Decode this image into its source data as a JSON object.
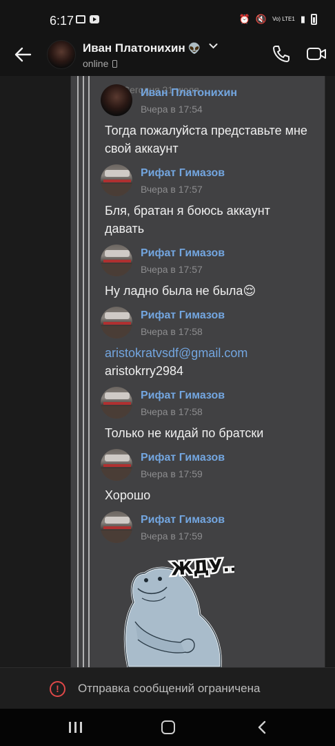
{
  "status_bar": {
    "time": "6:17",
    "signal": "Vo) LTE1"
  },
  "header": {
    "title": "Иван Платонихин",
    "title_emoji": "👽",
    "status": "online",
    "icons": {
      "back": "arrow-left-icon",
      "call": "phone-icon",
      "video": "video-camera-icon"
    }
  },
  "chat": {
    "date_divider": "Сегодня 21 июля",
    "messages": [
      {
        "sender": "Иван Платонихин",
        "time": "Вчера в 17:54",
        "text": "Тогда пожалуйста представьте мне свой аккаунт"
      },
      {
        "sender": "Рифат Гимазов",
        "time": "Вчера в 17:57",
        "text": "Бля, братан я боюсь аккаунт давать"
      },
      {
        "sender": "Рифат Гимазов",
        "time": "Вчера в 17:57",
        "text": "Ну ладно была не была😌"
      },
      {
        "sender": "Рифат Гимазов",
        "time": "Вчера в 17:58",
        "email": "aristokratvsdf@gmail.com",
        "text": "aristokrry2984"
      },
      {
        "sender": "Рифат Гимазов",
        "time": "Вчера в 17:58",
        "text": "Только не кидай по братски"
      },
      {
        "sender": "Рифат Гимазов",
        "time": "Вчера в 17:59",
        "text": "Хорошо"
      },
      {
        "sender": "Рифат Гимазов",
        "time": "Вчера в 17:59",
        "sticker_text": "ЖДУ..."
      }
    ]
  },
  "restriction": {
    "text": "Отправка сообщений ограничена",
    "icon": "alert-circle-icon",
    "color": "#e04848"
  },
  "nav": {
    "icons": [
      "recent-apps-icon",
      "home-icon",
      "back-chevron-icon"
    ]
  },
  "colors": {
    "accent": "#73a6e0",
    "panel": "#414143",
    "background": "#141414"
  }
}
